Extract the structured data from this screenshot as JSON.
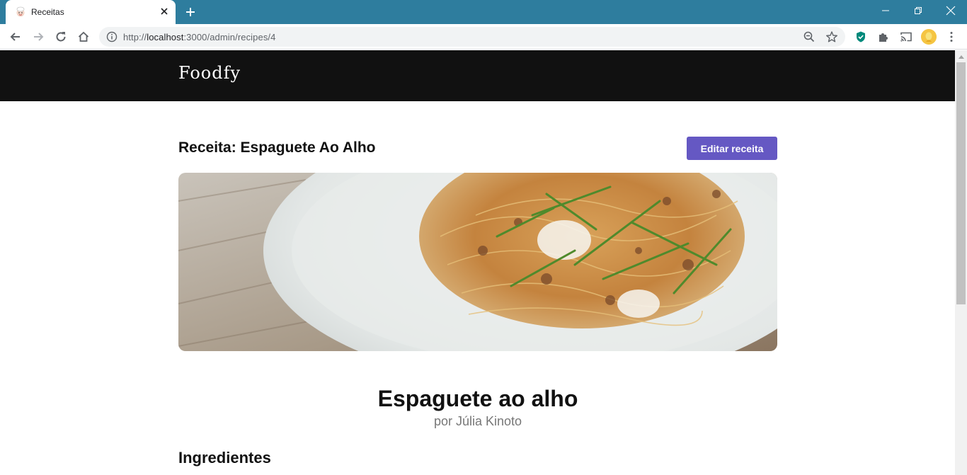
{
  "browser": {
    "tab_title": "Receitas",
    "url_scheme": "http://",
    "url_host": "localhost",
    "url_path": ":3000/admin/recipes/4",
    "icons": [
      "chef-favicon-icon",
      "close-icon",
      "plus-icon",
      "minimize-icon",
      "restore-icon",
      "close-window-icon",
      "back-icon",
      "forward-icon",
      "reload-icon",
      "home-icon",
      "info-icon",
      "zoom-out-icon",
      "star-icon",
      "shield-extension-icon",
      "extensions-puzzle-icon",
      "cast-icon",
      "profile-avatar",
      "menu-kebab-icon"
    ]
  },
  "site": {
    "logo": "Foodfy"
  },
  "page": {
    "heading": "Receita: Espaguete Ao Alho",
    "edit_button": "Editar receita",
    "hero_alt": "Espaguete ao alho",
    "recipe_title": "Espaguete ao alho",
    "recipe_author": "por Júlia Kinoto",
    "ingredients_title": "Ingredientes"
  },
  "colors": {
    "tabbar": "#2e7d9e",
    "header": "#111111",
    "accent": "#6558c3"
  }
}
